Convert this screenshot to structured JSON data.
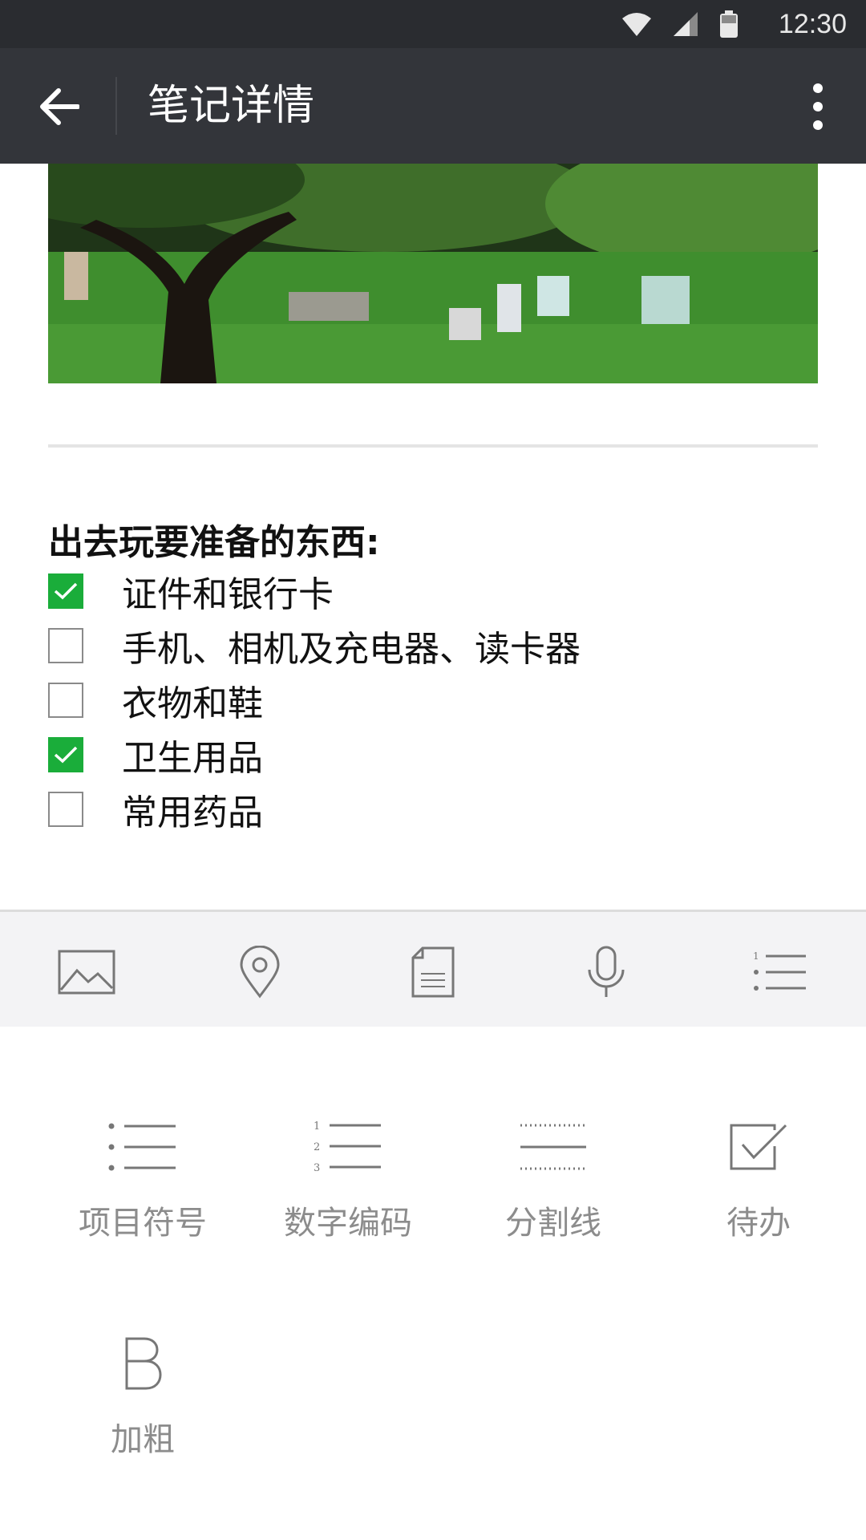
{
  "status_bar": {
    "time": "12:30"
  },
  "app_bar": {
    "title": "笔记详情"
  },
  "note": {
    "title": "出去玩要准备的东西:",
    "items": [
      {
        "label": "证件和银行卡",
        "checked": true
      },
      {
        "label": "手机、相机及充电器、读卡器",
        "checked": false
      },
      {
        "label": "衣物和鞋",
        "checked": false
      },
      {
        "label": "卫生用品",
        "checked": true
      },
      {
        "label": "常用药品",
        "checked": false
      }
    ]
  },
  "toolbar": {
    "icons": [
      "image-icon",
      "location-pin-icon",
      "document-icon",
      "microphone-icon",
      "numbered-list-icon"
    ]
  },
  "format_panel": {
    "items": [
      {
        "label": "项目符号",
        "icon": "bullet-list-icon"
      },
      {
        "label": "数字编码",
        "icon": "numbered-list-icon"
      },
      {
        "label": "分割线",
        "icon": "divider-line-icon"
      },
      {
        "label": "待办",
        "icon": "checkbox-todo-icon"
      },
      {
        "label": "加粗",
        "icon": "bold-icon"
      }
    ]
  },
  "colors": {
    "accent_green": "#1aad3a",
    "app_bar": "#33353a",
    "status_bar": "#2a2c30"
  }
}
